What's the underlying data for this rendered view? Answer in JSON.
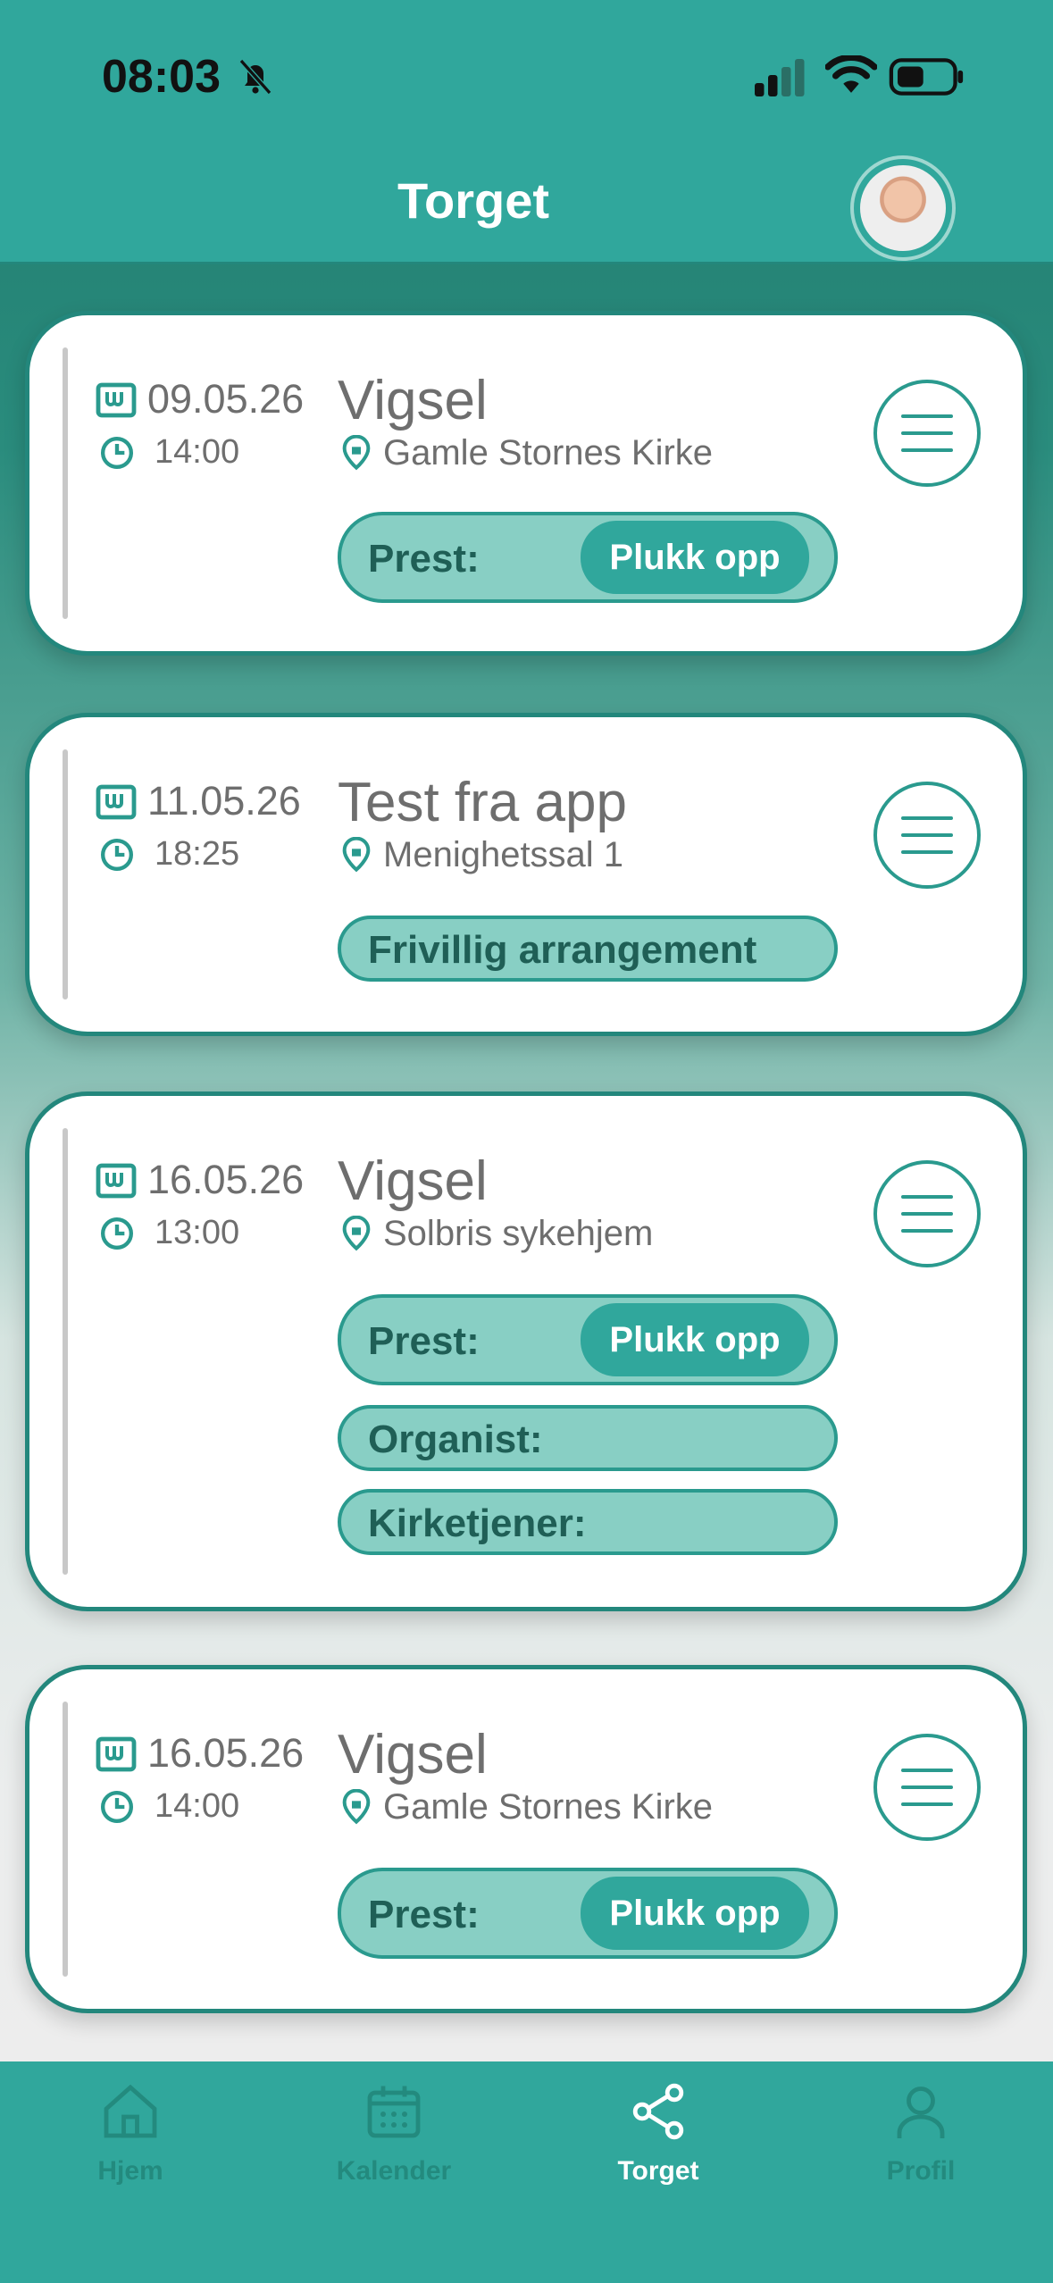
{
  "status": {
    "time": "08:03"
  },
  "header": {
    "title": "Torget"
  },
  "cards": [
    {
      "date": "09.05.26",
      "time": "14:00",
      "title": "Vigsel",
      "place": "Gamle Stornes Kirke",
      "roles": [
        {
          "label": "Prest:",
          "action": "Plukk opp"
        }
      ]
    },
    {
      "date": "11.05.26",
      "time": "18:25",
      "title": "Test fra app",
      "place": "Menighetssal 1",
      "roles": [
        {
          "label": "Frivillig arrangement"
        }
      ]
    },
    {
      "date": "16.05.26",
      "time": "13:00",
      "title": "Vigsel",
      "place": "Solbris sykehjem",
      "roles": [
        {
          "label": "Prest:",
          "action": "Plukk opp"
        },
        {
          "label": "Organist:"
        },
        {
          "label": "Kirketjener:"
        }
      ]
    },
    {
      "date": "16.05.26",
      "time": "14:00",
      "title": "Vigsel",
      "place": "Gamle Stornes Kirke",
      "roles": [
        {
          "label": "Prest:",
          "action": "Plukk opp"
        }
      ]
    }
  ],
  "tabs": [
    {
      "label": "Hjem",
      "icon": "home-icon"
    },
    {
      "label": "Kalender",
      "icon": "calendar-icon"
    },
    {
      "label": "Torget",
      "icon": "share-icon",
      "active": true
    },
    {
      "label": "Profil",
      "icon": "person-icon"
    }
  ],
  "colors": {
    "primary": "#30a79c",
    "dark": "#23877c",
    "pill": "#88cfc4",
    "text": "#6e6e6e"
  }
}
